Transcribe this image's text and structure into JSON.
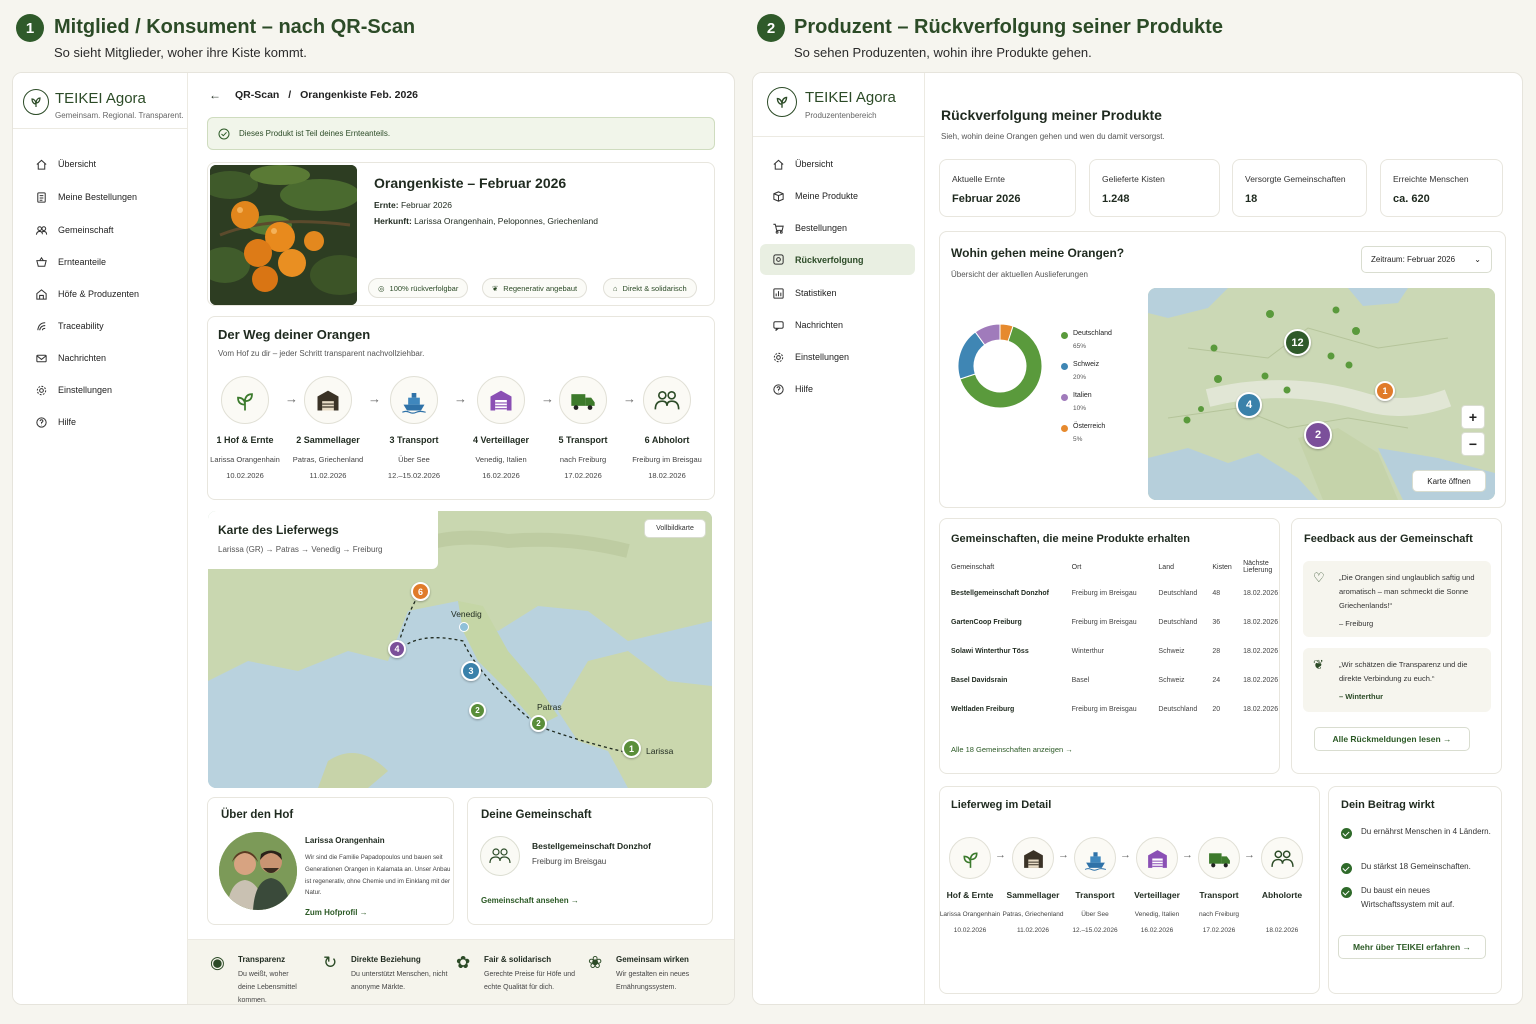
{
  "left": {
    "section_num": "1",
    "section_title": "Mitglied / Konsument – nach QR-Scan",
    "section_sub": "So sieht Mitglieder, woher ihre Kiste kommt.",
    "logo_name": "TEIKEI Agora",
    "logo_sub": "Gemeinsam. Regional. Transparent.",
    "nav": [
      "Übersicht",
      "Meine Bestellungen",
      "Gemeinschaft",
      "Ernteanteile",
      "Höfe & Produzenten",
      "Traceability",
      "Nachrichten",
      "Einstellungen",
      "Hilfe"
    ],
    "breadcrumb": {
      "a": "QR-Scan",
      "sep": "/",
      "b": "Orangenkiste Feb. 2026"
    },
    "banner": "Dieses Produkt ist Teil deines Ernteanteils.",
    "product": {
      "title": "Orangenkiste – Februar 2026",
      "harvest_label": "Ernte:",
      "harvest": "Februar 2026",
      "origin_label": "Herkunft:",
      "origin": "Larissa Orangenhain, Peloponnes, Griechenland",
      "pills": [
        "100% rückverfolgbar",
        "Regenerativ angebaut",
        "Direkt & solidarisch"
      ]
    },
    "route": {
      "title": "Der Weg deiner Orangen",
      "sub": "Vom Hof zu dir – jeder Schritt transparent nachvollziehbar.",
      "steps": [
        {
          "t": "1  Hof & Ernte",
          "a": "Larissa Orangenhain",
          "d": "10.02.2026"
        },
        {
          "t": "2  Sammellager",
          "a": "Patras, Griechenland",
          "d": "11.02.2026"
        },
        {
          "t": "3  Transport",
          "a": "Über See",
          "d": "12.–15.02.2026"
        },
        {
          "t": "4  Verteillager",
          "a": "Venedig, Italien",
          "d": "16.02.2026"
        },
        {
          "t": "5  Transport",
          "a": "nach Freiburg",
          "d": "17.02.2026"
        },
        {
          "t": "6  Abholort",
          "a": "Freiburg im Breisgau",
          "d": "18.02.2026"
        }
      ]
    },
    "map": {
      "title": "Karte des Lieferwegs",
      "sub": "Larissa (GR) → Patras → Venedig → Freiburg",
      "button": "Vollbildkarte",
      "labels": {
        "venedig": "Venedig",
        "patras": "Patras",
        "larissa": "Larissa"
      },
      "markers": [
        "6",
        "4",
        "3",
        "2",
        "2",
        "1"
      ]
    },
    "farm": {
      "title": "Über den Hof",
      "name": "Larissa Orangenhain",
      "text": "Wir sind die Familie Papadopoulos und bauen seit Generationen Orangen in Kalamata an. Unser Anbau ist regenerativ, ohne Chemie und im Einklang mit der Natur.",
      "link": "Zum Hofprofil"
    },
    "community": {
      "title": "Deine Gemeinschaft",
      "name": "Bestellgemeinschaft Donzhof",
      "place": "Freiburg im Breisgau",
      "link": "Gemeinschaft ansehen"
    },
    "footer": [
      {
        "t": "Transparenz",
        "d": "Du weißt, woher deine Lebensmittel kommen."
      },
      {
        "t": "Direkte Beziehung",
        "d": "Du unterstützt Menschen, nicht anonyme Märkte."
      },
      {
        "t": "Fair & solidarisch",
        "d": "Gerechte Preise für Höfe und echte Qualität für dich."
      },
      {
        "t": "Gemeinsam wirken",
        "d": "Wir gestalten ein neues Ernährungssystem."
      }
    ]
  },
  "right": {
    "section_num": "2",
    "section_title": "Produzent – Rückverfolgung seiner Produkte",
    "section_sub": "So sehen Produzenten, wohin ihre Produkte gehen.",
    "logo_name": "TEIKEI Agora",
    "logo_sub": "Produzentenbereich",
    "nav": [
      "Übersicht",
      "Meine Produkte",
      "Bestellungen",
      "Rückverfolgung",
      "Statistiken",
      "Nachrichten",
      "Einstellungen",
      "Hilfe"
    ],
    "page_title": "Rückverfolgung meiner Produkte",
    "page_sub": "Sieh, wohin deine Orangen gehen und wen du damit versorgst.",
    "stats": [
      {
        "l": "Aktuelle Ernte",
        "v": "Februar 2026"
      },
      {
        "l": "Gelieferte Kisten",
        "v": "1.248"
      },
      {
        "l": "Versorgte Gemeinschaften",
        "v": "18"
      },
      {
        "l": "Erreichte Menschen",
        "v": "ca. 620"
      }
    ],
    "dist": {
      "title": "Wohin gehen meine Orangen?",
      "sub": "Übersicht der aktuellen Auslieferungen",
      "period": "Zeitraum: Februar 2026",
      "map_button": "Karte öffnen",
      "zoom_in": "+",
      "zoom_out": "−",
      "clusters": [
        "12",
        "4",
        "2",
        "1"
      ]
    },
    "chart_data": {
      "type": "pie",
      "categories": [
        "Deutschland",
        "Schweiz",
        "Italien",
        "Österreich"
      ],
      "values": [
        65,
        20,
        10,
        5
      ],
      "value_labels": [
        "65%",
        "20%",
        "10%",
        "5%"
      ],
      "colors": [
        "#5a9a3c",
        "#3f86b4",
        "#a07bbb",
        "#e68a2e"
      ]
    },
    "communities": {
      "title": "Gemeinschaften, die meine Produkte erhalten",
      "headers": [
        "Gemeinschaft",
        "Ort",
        "Land",
        "Kisten",
        "Nächste Lieferung"
      ],
      "rows": [
        [
          "Bestellgemeinschaft Donzhof",
          "Freiburg im Breisgau",
          "Deutschland",
          "48",
          "18.02.2026"
        ],
        [
          "GartenCoop Freiburg",
          "Freiburg im Breisgau",
          "Deutschland",
          "36",
          "18.02.2026"
        ],
        [
          "Solawi Winterthur Töss",
          "Winterthur",
          "Schweiz",
          "28",
          "18.02.2026"
        ],
        [
          "Basel Davidsrain",
          "Basel",
          "Schweiz",
          "24",
          "18.02.2026"
        ],
        [
          "Weltladen Freiburg",
          "Freiburg im Breisgau",
          "Deutschland",
          "20",
          "18.02.2026"
        ]
      ],
      "link": "Alle 18 Gemeinschaften anzeigen"
    },
    "feedback": {
      "title": "Feedback aus der Gemeinschaft",
      "items": [
        {
          "q": "„Die Orangen sind unglaublich saftig und aromatisch – man schmeckt die Sonne Griechenlands!“",
          "a": "– Freiburg"
        },
        {
          "q": "„Wir schätzen die Transparenz und die direkte Verbindung zu euch.“",
          "a": "– Winterthur"
        }
      ],
      "button": "Alle Rückmeldungen lesen"
    },
    "route": {
      "title": "Lieferweg im Detail",
      "steps": [
        {
          "t": "Hof & Ernte",
          "a": "Larissa Orangenhain",
          "d": "10.02.2026"
        },
        {
          "t": "Sammellager",
          "a": "Patras, Griechenland",
          "d": "11.02.2026"
        },
        {
          "t": "Transport",
          "a": "Über See",
          "d": "12.–15.02.2026"
        },
        {
          "t": "Verteillager",
          "a": "Venedig, Italien",
          "d": "16.02.2026"
        },
        {
          "t": "Transport",
          "a": "nach Freiburg",
          "d": "17.02.2026"
        },
        {
          "t": "Abholorte",
          "a": "",
          "d": "18.02.2026"
        }
      ]
    },
    "impact": {
      "title": "Dein Beitrag wirkt",
      "items": [
        "Du ernährst Menschen in 4 Ländern.",
        "Du stärkst 18 Gemeinschaften.",
        "Du baust ein neues Wirtschaftssystem mit auf."
      ],
      "button": "Mehr über TEIKEI erfahren"
    }
  }
}
